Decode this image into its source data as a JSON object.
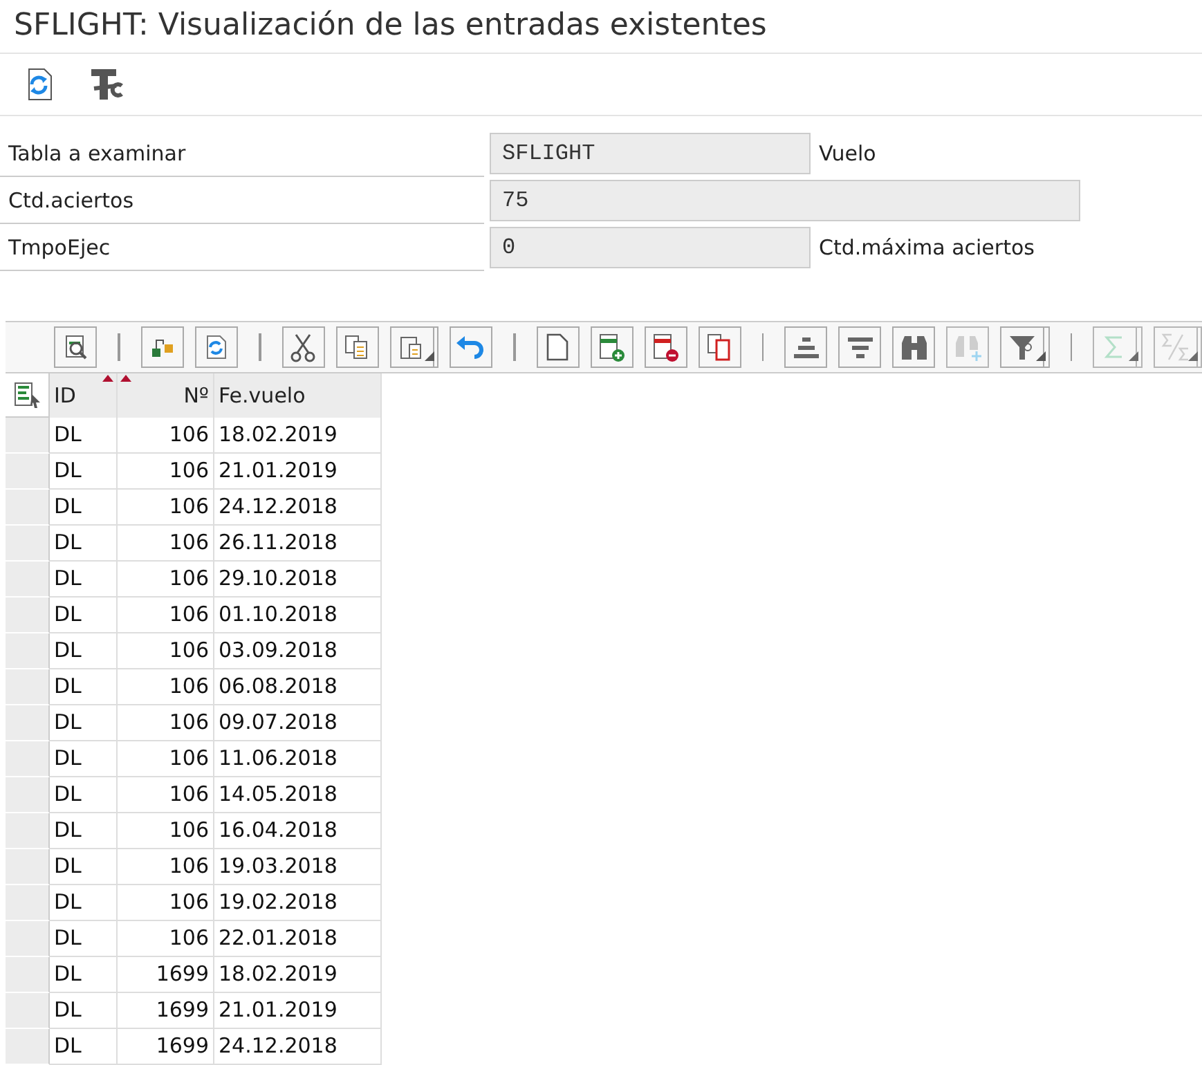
{
  "window": {
    "title": "SFLIGHT: Visualización de las entradas existentes"
  },
  "app_toolbar": [
    {
      "kind": "refresh"
    },
    {
      "kind": "tools"
    }
  ],
  "form": [
    {
      "label": "Tabla a examinar",
      "value": "SFLIGHT",
      "note": "Vuelo"
    },
    {
      "label": "Ctd.aciertos",
      "value": "75"
    },
    {
      "label": "TmpoEjec",
      "value": "0",
      "note": "Ctd.máxima aciertos"
    }
  ],
  "alv_toolbar": [
    {
      "kind": "button",
      "disabled": false
    },
    {
      "kind": "separator"
    },
    {
      "kind": "button",
      "disabled": false
    },
    {
      "kind": "button",
      "disabled": false
    },
    {
      "kind": "separator"
    },
    {
      "kind": "button",
      "disabled": false
    },
    {
      "kind": "button",
      "disabled": false
    },
    {
      "kind": "menu",
      "disabled": false
    },
    {
      "kind": "button",
      "disabled": false
    },
    {
      "kind": "separator"
    },
    {
      "kind": "button",
      "disabled": false
    },
    {
      "kind": "button",
      "disabled": false
    },
    {
      "kind": "button",
      "disabled": false
    },
    {
      "kind": "button",
      "disabled": false
    },
    {
      "kind": "separator"
    },
    {
      "kind": "button",
      "disabled": false
    },
    {
      "kind": "button",
      "disabled": false
    },
    {
      "kind": "button",
      "disabled": false
    },
    {
      "kind": "button",
      "disabled": true
    },
    {
      "kind": "menu",
      "disabled": false
    },
    {
      "kind": "separator"
    },
    {
      "kind": "menu",
      "disabled": true
    },
    {
      "kind": "menu",
      "disabled": true
    }
  ],
  "table": {
    "columns": [
      {
        "label": "ID",
        "kind": "text",
        "key_mark": true
      },
      {
        "label": "Nº",
        "kind": "number",
        "key_mark": true
      },
      {
        "label": "Fe.vuelo",
        "kind": "text",
        "key_mark": false
      }
    ],
    "rows": [
      [
        "DL",
        "106",
        "18.02.2019"
      ],
      [
        "DL",
        "106",
        "21.01.2019"
      ],
      [
        "DL",
        "106",
        "24.12.2018"
      ],
      [
        "DL",
        "106",
        "26.11.2018"
      ],
      [
        "DL",
        "106",
        "29.10.2018"
      ],
      [
        "DL",
        "106",
        "01.10.2018"
      ],
      [
        "DL",
        "106",
        "03.09.2018"
      ],
      [
        "DL",
        "106",
        "06.08.2018"
      ],
      [
        "DL",
        "106",
        "09.07.2018"
      ],
      [
        "DL",
        "106",
        "11.06.2018"
      ],
      [
        "DL",
        "106",
        "14.05.2018"
      ],
      [
        "DL",
        "106",
        "16.04.2018"
      ],
      [
        "DL",
        "106",
        "19.03.2018"
      ],
      [
        "DL",
        "106",
        "19.02.2018"
      ],
      [
        "DL",
        "106",
        "22.01.2018"
      ],
      [
        "DL",
        "1699",
        "18.02.2019"
      ],
      [
        "DL",
        "1699",
        "21.01.2019"
      ],
      [
        "DL",
        "1699",
        "24.12.2018"
      ]
    ]
  }
}
